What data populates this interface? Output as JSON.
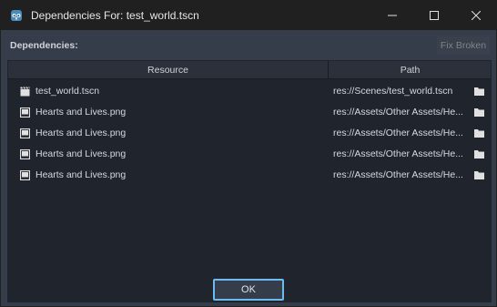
{
  "window": {
    "title": "Dependencies For: test_world.tscn",
    "controls": [
      "minimize",
      "maximize",
      "close"
    ]
  },
  "dependencies_label": "Dependencies:",
  "fix_broken_label": "Fix Broken",
  "table": {
    "columns": [
      "Resource",
      "Path"
    ],
    "rows": [
      {
        "icon": "scene-icon",
        "name": "test_world.tscn",
        "path": "res://Scenes/test_world.tscn"
      },
      {
        "icon": "image-icon",
        "name": "Hearts and Lives.png",
        "path": "res://Assets/Other Assets/He..."
      },
      {
        "icon": "image-icon",
        "name": "Hearts and Lives.png",
        "path": "res://Assets/Other Assets/He..."
      },
      {
        "icon": "image-icon",
        "name": "Hearts and Lives.png",
        "path": "res://Assets/Other Assets/He..."
      },
      {
        "icon": "image-icon",
        "name": "Hearts and Lives.png",
        "path": "res://Assets/Other Assets/He..."
      }
    ]
  },
  "ok_label": "OK",
  "colors": {
    "accent": "#6bbbf0",
    "background": "#363d4a",
    "panel": "#20242c"
  }
}
